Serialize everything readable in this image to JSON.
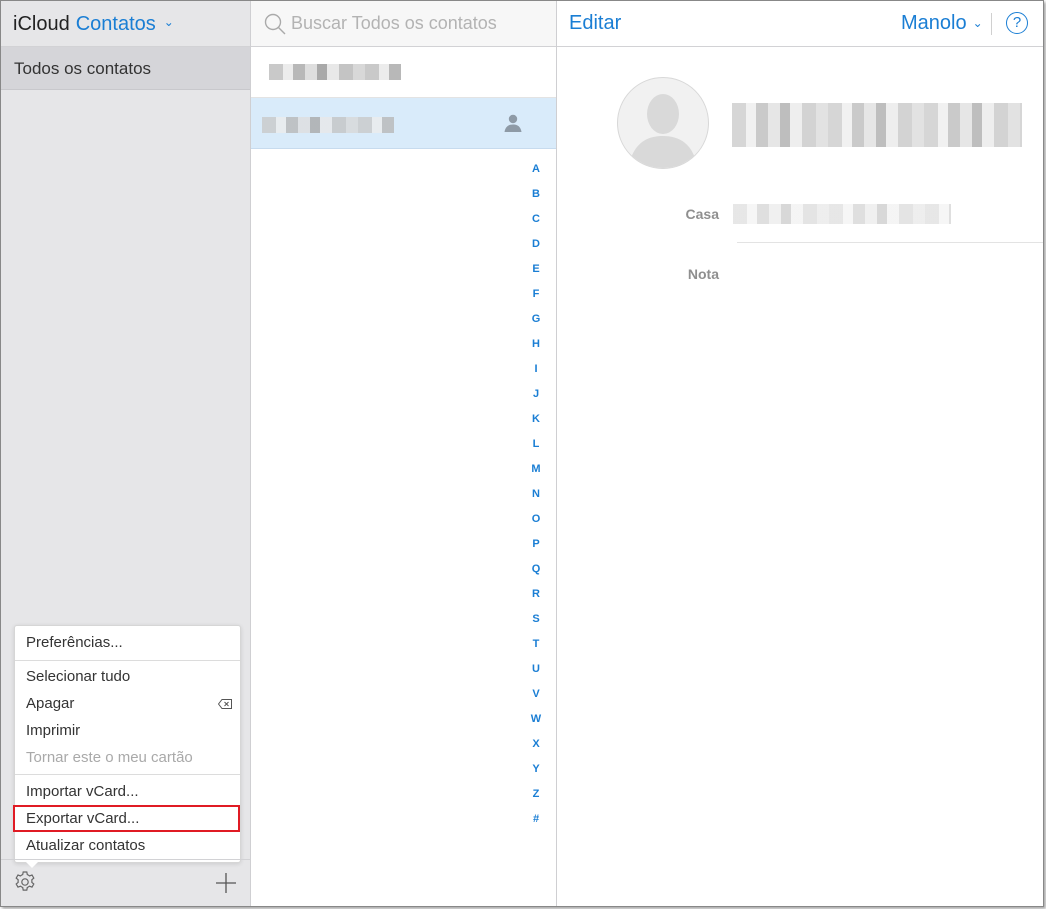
{
  "sidebar": {
    "brand": "iCloud",
    "app_name": "Contatos",
    "groups": [
      {
        "label": "Todos os contatos"
      }
    ]
  },
  "menu": {
    "items": [
      {
        "label": "Preferências..."
      },
      {
        "label": "Selecionar tudo"
      },
      {
        "label": "Apagar"
      },
      {
        "label": "Imprimir"
      },
      {
        "label": "Tornar este o meu cartão"
      },
      {
        "label": "Importar vCard..."
      },
      {
        "label": "Exportar vCard..."
      },
      {
        "label": "Atualizar contatos"
      }
    ]
  },
  "search": {
    "placeholder": "Buscar Todos os contatos"
  },
  "alphabet": [
    "A",
    "B",
    "C",
    "D",
    "E",
    "F",
    "G",
    "H",
    "I",
    "J",
    "K",
    "L",
    "M",
    "N",
    "O",
    "P",
    "Q",
    "R",
    "S",
    "T",
    "U",
    "V",
    "W",
    "X",
    "Y",
    "Z",
    "#"
  ],
  "detail": {
    "edit_label": "Editar",
    "user_name": "Manolo",
    "help_label": "?",
    "fields": [
      {
        "label": "Casa"
      },
      {
        "label": "Nota"
      }
    ]
  },
  "colors": {
    "accent": "#1a7ed4",
    "highlight": "#e01b24",
    "selected_row": "#d9ebfa"
  }
}
